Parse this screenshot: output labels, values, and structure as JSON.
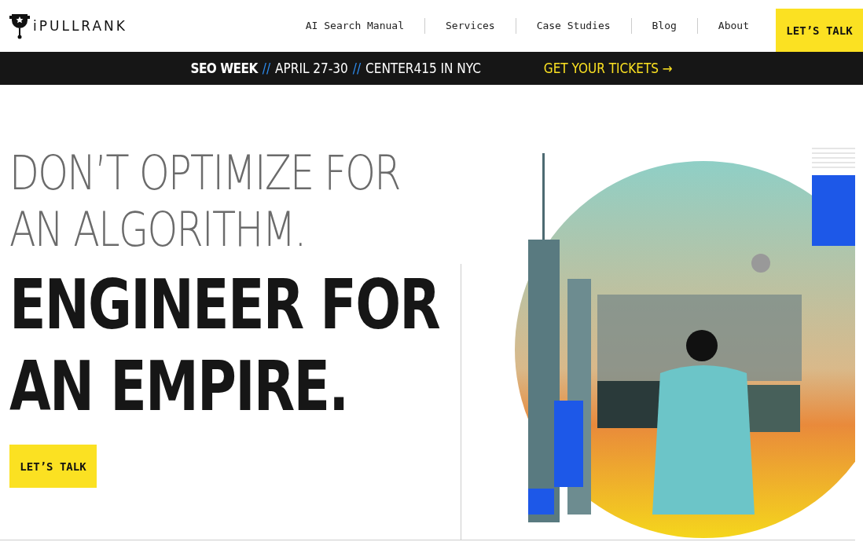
{
  "header": {
    "logo_text": "iPULLRANK",
    "nav": [
      {
        "label": "AI Search Manual"
      },
      {
        "label": "Services"
      },
      {
        "label": "Case Studies"
      },
      {
        "label": "Blog"
      },
      {
        "label": "About"
      }
    ],
    "cta": "LET’S TALK"
  },
  "banner": {
    "parts": [
      {
        "kind": "brand",
        "text": "SEO WEEK"
      },
      {
        "kind": "sep",
        "text": "//"
      },
      {
        "kind": "plain",
        "text": "APRIL 27-30"
      },
      {
        "kind": "sep",
        "text": "//"
      },
      {
        "kind": "plain",
        "text": "CENTER415 IN NYC"
      }
    ],
    "link": "GET YOUR TICKETS →"
  },
  "hero": {
    "headline_light": [
      "DON’T OPTIMIZE FOR",
      "AN ALGORITHM."
    ],
    "headline_bold": [
      "ENGINEER FOR",
      "AN EMPIRE."
    ],
    "cta": "LET’S TALK"
  }
}
